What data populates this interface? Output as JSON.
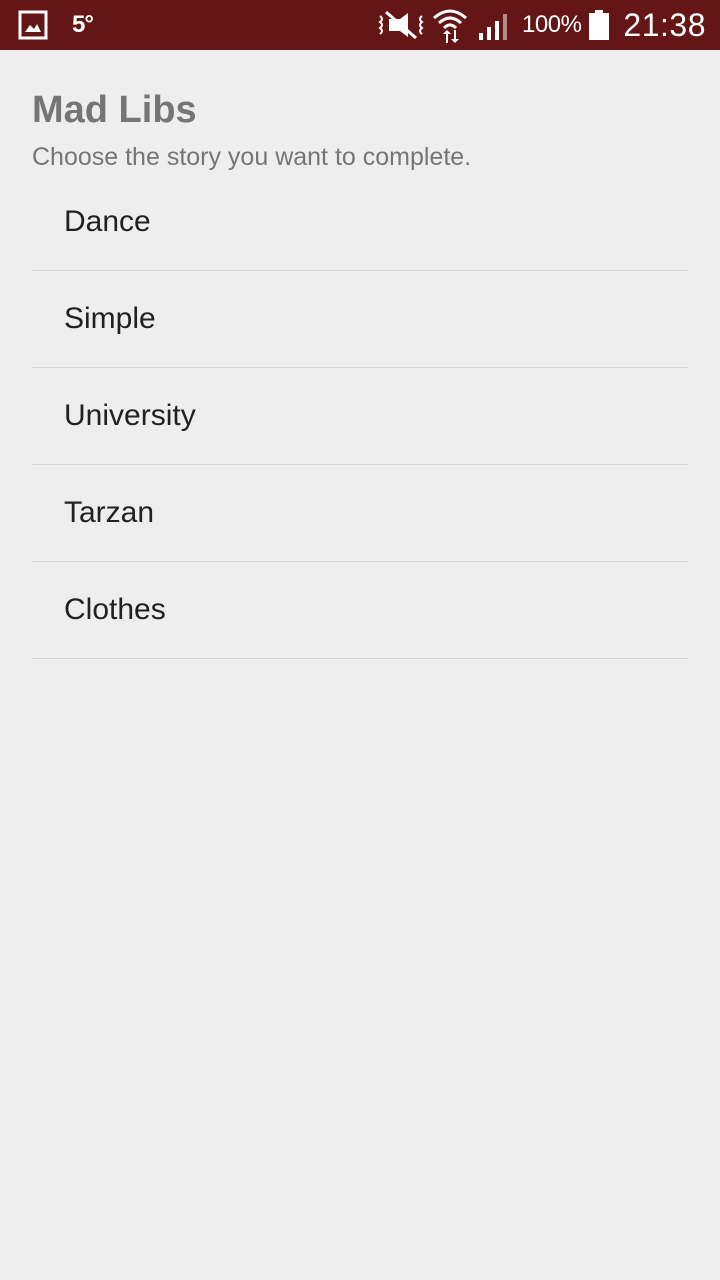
{
  "colors": {
    "status_bar": "#641616",
    "background": "#eeeeee",
    "title_text": "#757575",
    "item_text": "#212121",
    "divider": "#d6d6d6"
  },
  "status_bar": {
    "temperature": "5°",
    "battery": "100%",
    "time": "21:38",
    "icons": [
      "gallery-icon",
      "mute-icon",
      "wifi-icon",
      "signal-icon",
      "battery-icon"
    ]
  },
  "page": {
    "title": "Mad Libs",
    "subtitle": "Choose the story you want to complete."
  },
  "stories": [
    {
      "label": "Dance"
    },
    {
      "label": "Simple"
    },
    {
      "label": "University"
    },
    {
      "label": "Tarzan"
    },
    {
      "label": "Clothes"
    }
  ]
}
